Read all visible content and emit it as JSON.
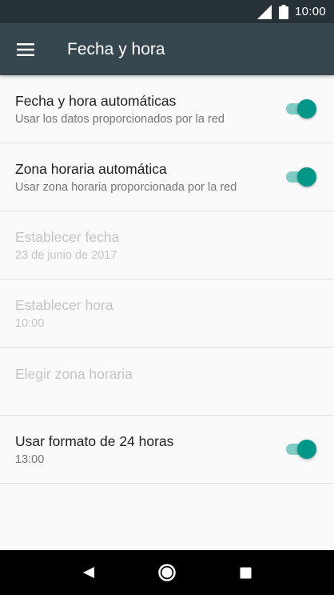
{
  "status_bar": {
    "time": "10:00",
    "signal_icon": "signal-icon",
    "battery_icon": "battery-icon"
  },
  "app_bar": {
    "title": "Fecha y hora",
    "menu_icon": "hamburger-menu-icon"
  },
  "settings": [
    {
      "title": "Fecha y hora automáticas",
      "subtitle": "Usar los datos proporcionados por la red",
      "enabled": true,
      "switch": true,
      "checked": true
    },
    {
      "title": "Zona horaria automática",
      "subtitle": "Usar zona horaria proporcionada por la red",
      "enabled": true,
      "switch": true,
      "checked": true
    },
    {
      "title": "Establecer fecha",
      "subtitle": "23 de junio de 2017",
      "enabled": false,
      "switch": false
    },
    {
      "title": "Establecer hora",
      "subtitle": "10:00",
      "enabled": false,
      "switch": false
    },
    {
      "title": "Elegir zona horaria",
      "subtitle": "",
      "enabled": false,
      "switch": false
    },
    {
      "title": "Usar formato de 24 horas",
      "subtitle": "13:00",
      "enabled": true,
      "switch": true,
      "checked": true
    }
  ],
  "nav_bar": {
    "back_icon": "back-triangle-icon",
    "home_icon": "home-circle-icon",
    "recents_icon": "recents-square-icon"
  },
  "colors": {
    "status_bar": "#263238",
    "app_bar": "#37474f",
    "accent": "#009688",
    "accent_track": "#80cbc4",
    "disabled_text": "#c4c4c4"
  }
}
